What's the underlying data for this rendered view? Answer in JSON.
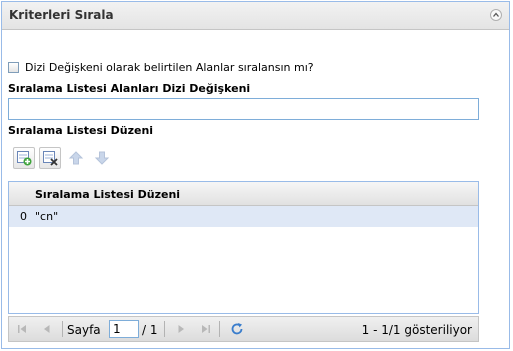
{
  "panel": {
    "title": "Kriterleri Sırala",
    "collapse_icon": "chevron-up-icon"
  },
  "checkbox": {
    "label": "Dizi Değişkeni olarak belirtilen Alanlar sıralansın mı?",
    "checked": false
  },
  "array_field": {
    "label": "Sıralama Listesi Alanları Dizi Değişkeni",
    "value": ""
  },
  "order_section": {
    "label": "Sıralama Listesi Düzeni"
  },
  "toolbar": {
    "add_icon": "add-row-icon",
    "remove_icon": "remove-row-icon",
    "up_icon": "move-up-icon",
    "down_icon": "move-down-icon"
  },
  "grid": {
    "column_header": "Sıralama Listesi Düzeni",
    "rows": [
      {
        "index": "0",
        "value": "\"cn\""
      }
    ]
  },
  "pager": {
    "page_label": "Sayfa",
    "page_value": "1",
    "of_label": "/ 1",
    "display_text": "1 - 1/1 gösteriliyor",
    "accent_color": "#3a7dcc"
  }
}
